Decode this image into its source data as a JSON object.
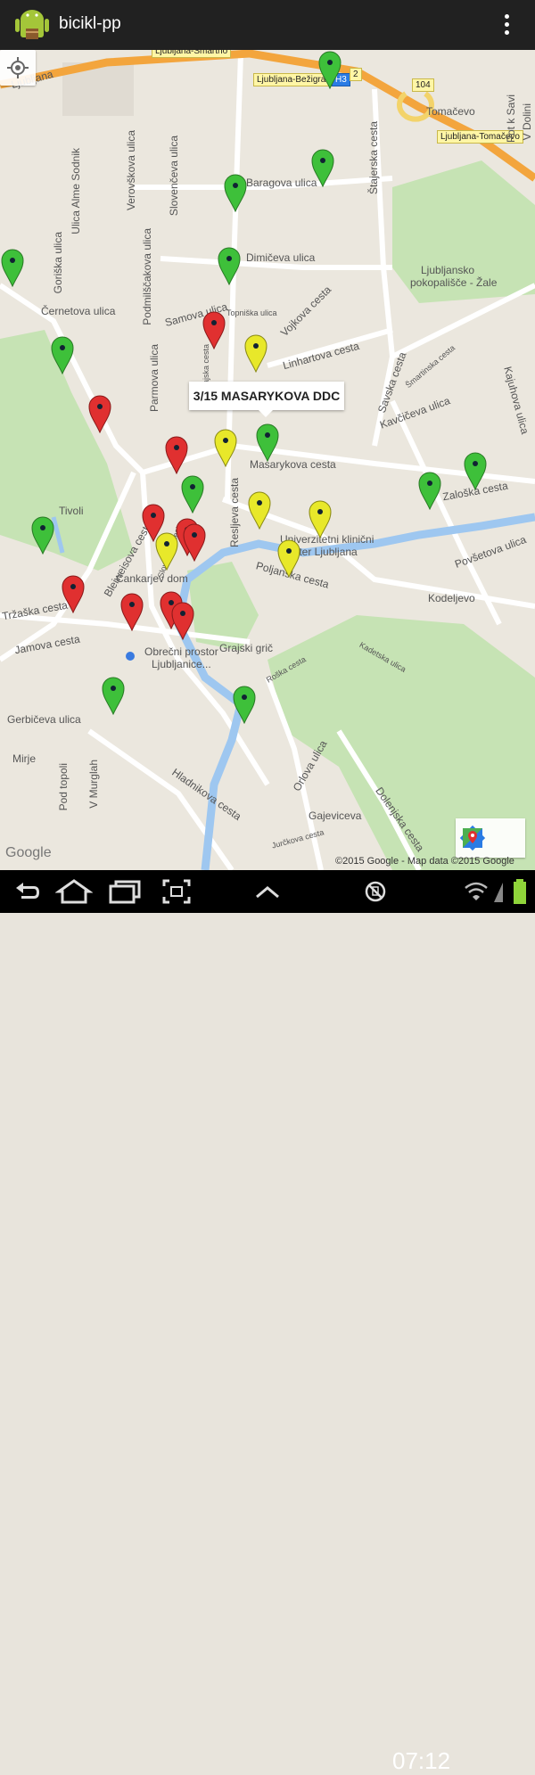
{
  "app": {
    "title": "bicikl-pp"
  },
  "map": {
    "info_window": "3/15 MASARYKOVA DDC",
    "attribution": "©2015 Google - Map data ©2015 Google",
    "google_logo": "Google",
    "road_signs": [
      "Ljubljana-Šmartno",
      "Ljubljana-Bežigrad",
      "H3",
      "2",
      "104",
      "Ljubljana-Tomačevo"
    ],
    "labels": {
      "ljubljana": "Ljubljana",
      "tomacevo": "Tomačevo",
      "pot_k_savi": "Pot k Savi",
      "v_dolini": "V Dolini",
      "ulica_alme": "Ulica Alme Sodnik",
      "verovskova": "Verovškova ulica",
      "slovenceva": "Slovenčeva ulica",
      "baragova": "Baragova ulica",
      "stajerska": "Štajerska cesta",
      "goriska": "Goriška ulica",
      "podmilscakova": "Podmilščakova ulica",
      "dimiceva": "Dimičeva ulica",
      "pokopalisce1": "Ljubljansko",
      "pokopalisce2": "pokopališče - Žale",
      "cernetova": "Černetova ulica",
      "samova": "Samova ulica",
      "topniska": "Topniška ulica",
      "vojkova": "Vojkova cesta",
      "linhartova": "Linhartova cesta",
      "parmova": "Parmova ulica",
      "dunajska": "Dunajska cesta",
      "savska": "Savska cesta",
      "smartinska": "Šmartinska cesta",
      "kaviceva": "Kavčičeva ulica",
      "kajuhova": "Kajuhova ulica",
      "masarykova": "Masarykova cesta",
      "zaloska": "Zaloška cesta",
      "tivoli": "Tivoli",
      "bleiweisova": "Bleiweisova cesta",
      "slovenska": "Slovenska cesta",
      "resljeva": "Resljeva cesta",
      "ukc1": "Univerzitetni klinični",
      "ukc2": "center Ljubljana",
      "povsetova": "Povšetova ulica",
      "poljanska": "Poljanska cesta",
      "cankarjev": "Cankarjev dom",
      "kodeljevo": "Kodeljevo",
      "trzaska": "Tržaška cesta",
      "jamova": "Jamova cesta",
      "obrecni1": "Obrečni prostor",
      "obrecni2": "Ljubljanice...",
      "grajski": "Grajski grič",
      "roska": "Roška cesta",
      "kadetska": "Kadetska ulica",
      "gerbiceva": "Gerbičeva ulica",
      "mirje": "Mirje",
      "podtopoli": "Pod topoli",
      "vmurglah": "V Murglah",
      "hladnikova": "Hladnikova cesta",
      "orlova": "Orlova ulica",
      "gajeviceva": "Gajeviceva",
      "jurckova": "Jurčkova cesta",
      "dolenjska": "Dolenjska cesta"
    }
  },
  "status_bar": {
    "time": "07:12"
  },
  "colors": {
    "green": "#3ec03a",
    "yellow": "#e8e82a",
    "red": "#e03030",
    "actionbar": "#212121"
  }
}
